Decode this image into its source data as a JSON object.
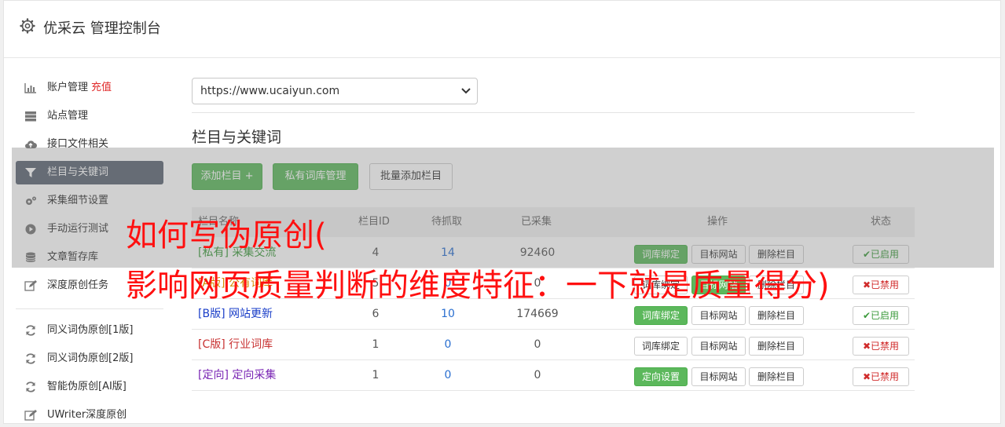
{
  "header": {
    "title": "优采云 管理控制台",
    "icon": "gear-icon"
  },
  "sidebar": {
    "items": [
      {
        "label": "账户管理",
        "extra": "充值",
        "icon": "bar-chart-icon"
      },
      {
        "label": "站点管理",
        "icon": "server-icon"
      },
      {
        "label": "接口文件相关",
        "icon": "cloud-upload-icon"
      },
      {
        "label": "栏目与关键词",
        "icon": "filter-icon",
        "active": true
      },
      {
        "label": "采集细节设置",
        "icon": "cogs-icon"
      },
      {
        "label": "手动运行测试",
        "icon": "play-circle-icon"
      },
      {
        "label": "文章暂存库",
        "icon": "database-icon"
      },
      {
        "label": "深度原创任务",
        "icon": "edit-icon"
      },
      {
        "label": "同义词伪原创[1版]",
        "icon": "refresh-icon"
      },
      {
        "label": "同义词伪原创[2版]",
        "icon": "refresh-icon"
      },
      {
        "label": "智能伪原创[AI版]",
        "icon": "refresh-icon"
      },
      {
        "label": "UWriter深度原创",
        "icon": "edit-icon"
      }
    ]
  },
  "main": {
    "site_select": {
      "value": "https://www.ucaiyun.com"
    },
    "section_title": "栏目与关键词",
    "buttons": {
      "add_column": "添加栏目 +",
      "private_lib": "私有词库管理",
      "batch_add": "批量添加栏目"
    },
    "table": {
      "headers": [
        "栏目名称",
        "栏目ID",
        "待抓取",
        "已采集",
        "操作",
        "状态"
      ],
      "rows": [
        {
          "tag": "[私有]",
          "name": "采集交流",
          "id": "4",
          "pending": "14",
          "collected": "92460",
          "op1": "词库绑定",
          "op2": "目标网站",
          "op3": "删除栏目",
          "status": "已启用"
        },
        {
          "tag": "[A版]",
          "name": "公有词库",
          "id": "5",
          "pending": "0",
          "collected": "0",
          "op1": "词库绑定",
          "op2": "目标网站",
          "op3": "删除栏目",
          "status": "已禁用"
        },
        {
          "tag": "[B版]",
          "name": "网站更新",
          "id": "6",
          "pending": "10",
          "collected": "174669",
          "op1": "词库绑定",
          "op2": "目标网站",
          "op3": "删除栏目",
          "status": "已启用"
        },
        {
          "tag": "[C版]",
          "name": "行业词库",
          "id": "1",
          "pending": "0",
          "collected": "0",
          "op1": "词库绑定",
          "op2": "目标网站",
          "op3": "删除栏目",
          "status": "已禁用"
        },
        {
          "tag": "[定向]",
          "name": "定向采集",
          "id": "1",
          "pending": "0",
          "collected": "0",
          "op1": "定向设置",
          "op2": "目标网站",
          "op3": "删除栏目",
          "status": "已禁用"
        }
      ]
    }
  },
  "overlay": {
    "line1": "如何写伪原创(",
    "line2": "影响网页质量判断的维度特征：一下就是质量得分)"
  },
  "colors": {
    "green": "#5cb85c",
    "active_nav": "#5c6673",
    "red_text": "#ff1010"
  }
}
